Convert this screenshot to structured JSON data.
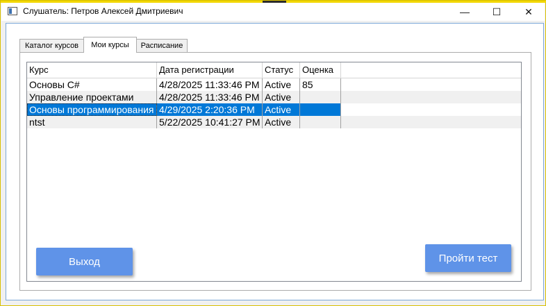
{
  "window": {
    "title": "Слушатель: Петров Алексей Дмитриевич",
    "minimize_glyph": "—",
    "maximize_glyph": "☐",
    "close_glyph": "✕"
  },
  "tabs": [
    {
      "label": "Каталог курсов",
      "active": false
    },
    {
      "label": "Мои курсы",
      "active": true
    },
    {
      "label": "Расписание",
      "active": false
    }
  ],
  "grid": {
    "columns": [
      "Курс",
      "Дата регистрации",
      "Статус",
      "Оценка"
    ],
    "rows": [
      {
        "course": "Основы C#",
        "date": "4/28/2025 11:33:46 PM",
        "status": "Active",
        "grade": "85"
      },
      {
        "course": "Управление проектами",
        "date": "4/28/2025 11:33:46 PM",
        "status": "Active",
        "grade": ""
      },
      {
        "course": "Основы программирования",
        "date": "4/29/2025 2:20:36 PM",
        "status": "Active",
        "grade": ""
      },
      {
        "course": "ntst",
        "date": "5/22/2025 10:41:27 PM",
        "status": "Active",
        "grade": ""
      }
    ],
    "selected_row": 2
  },
  "buttons": {
    "exit_label": "Выход",
    "take_test_label": "Пройти тест"
  },
  "colors": {
    "accent_button": "#5f93e8",
    "selection": "#0078d7",
    "frame_border": "#7aa7d8"
  }
}
